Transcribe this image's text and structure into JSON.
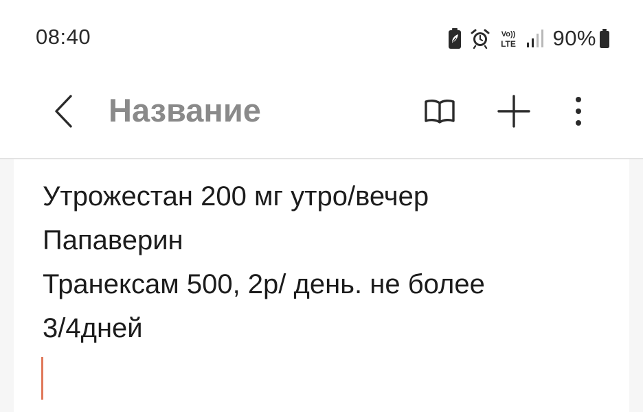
{
  "status_bar": {
    "time": "08:40",
    "icons": [
      "battery-saver-icon",
      "alarm-icon",
      "volte-lte-icon",
      "signal-icon"
    ],
    "volte_label_top": "Vo))",
    "volte_label_bottom": "LTE",
    "battery_percent": "90%"
  },
  "app_bar": {
    "title": "Название",
    "back_icon": "chevron-left-icon",
    "actions": [
      "reading-mode-icon",
      "plus-icon",
      "more-vertical-icon"
    ]
  },
  "note": {
    "lines": [
      "Утрожестан 200 мг утро/вечер",
      "Папаверин",
      "Транексам 500, 2р/ день. не более",
      "3/4дней"
    ],
    "cursor_color": "#e0785a"
  },
  "colors": {
    "title_gray": "#8a8a8a",
    "background_gutter": "#f6f6f6",
    "text": "#1c1c1c"
  }
}
